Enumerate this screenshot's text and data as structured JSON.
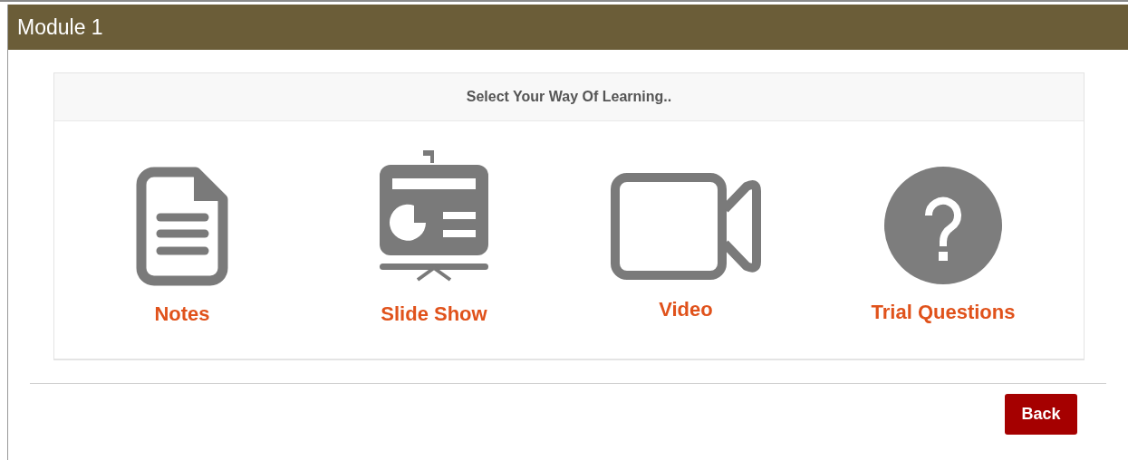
{
  "header": {
    "title": "Module 1"
  },
  "panel": {
    "heading": "Select Your Way Of Learning.."
  },
  "options": [
    {
      "kind": "notes",
      "label": "Notes"
    },
    {
      "kind": "slides",
      "label": "Slide Show"
    },
    {
      "kind": "video",
      "label": "Video"
    },
    {
      "kind": "questions",
      "label": "Trial Questions"
    }
  ],
  "buttons": [
    {
      "label": "Back"
    }
  ]
}
